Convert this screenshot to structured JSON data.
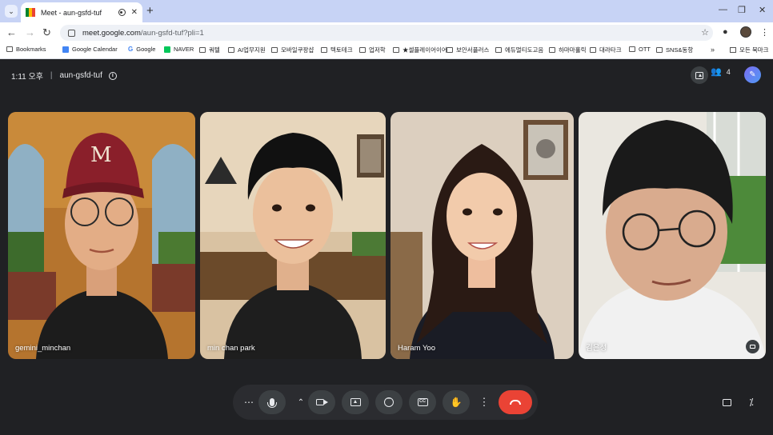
{
  "browser": {
    "tab_title": "Meet - aun-gsfd-tuf",
    "tab_close": "✕",
    "new_tab": "+",
    "window_controls": [
      "—",
      "❐",
      "✕"
    ],
    "url_domain": "meet.google.com",
    "url_path": "/aun-gsfd-tuf?pli=1",
    "nav": {
      "back": "←",
      "forward": "→",
      "reload": "↻"
    },
    "star": "☆"
  },
  "bookmarks": {
    "items": [
      {
        "label": "Bookmarks",
        "icon": "bookmark-icon"
      },
      {
        "label": "Google Calendar",
        "icon": "calendar-icon"
      },
      {
        "label": "Google",
        "icon": "google-icon"
      },
      {
        "label": "NAVER",
        "icon": "naver-icon"
      },
      {
        "label": "쿼텔",
        "icon": "folder-icon"
      },
      {
        "label": "AI업무지원",
        "icon": "folder-icon"
      },
      {
        "label": "모바일쿠팡샵",
        "icon": "folder-icon"
      },
      {
        "label": "텍토테크",
        "icon": "folder-icon"
      },
      {
        "label": "업저학",
        "icon": "folder-icon"
      },
      {
        "label": "★셀플레이어이어",
        "icon": "folder-icon"
      },
      {
        "label": "보안서플러스",
        "icon": "folder-icon"
      },
      {
        "label": "에듀멀티도고음",
        "icon": "folder-icon"
      },
      {
        "label": "하마마홀릭",
        "icon": "folder-icon"
      },
      {
        "label": "대라타크",
        "icon": "folder-icon"
      },
      {
        "label": "OTT",
        "icon": "folder-icon"
      },
      {
        "label": "SNS&동항",
        "icon": "folder-icon"
      }
    ],
    "more": "»",
    "all_bookmarks": "모든 북마크"
  },
  "meeting": {
    "time": "1:11 오후",
    "separator": "|",
    "code": "aun-gsfd-tuf",
    "info_glyph": "i",
    "people_count": "4"
  },
  "participants": [
    {
      "name": "gemini_minchan"
    },
    {
      "name": "min chan park"
    },
    {
      "name": "Haram Yoo"
    },
    {
      "name": "김은성"
    }
  ],
  "controls": {
    "more_options": "⋯",
    "arrow_up": "⌃",
    "kebab": "⋮",
    "emoji_glyph": "︶",
    "cc_glyph": "CC",
    "hand_glyph": "✋",
    "end_glyph": "☎",
    "activities_glyph": "⁒"
  },
  "colors": {
    "background": "#202124",
    "end_call": "#ea4335",
    "gemini_gradient_start": "#7b6cf0",
    "gemini_gradient_end": "#4f9af5"
  }
}
